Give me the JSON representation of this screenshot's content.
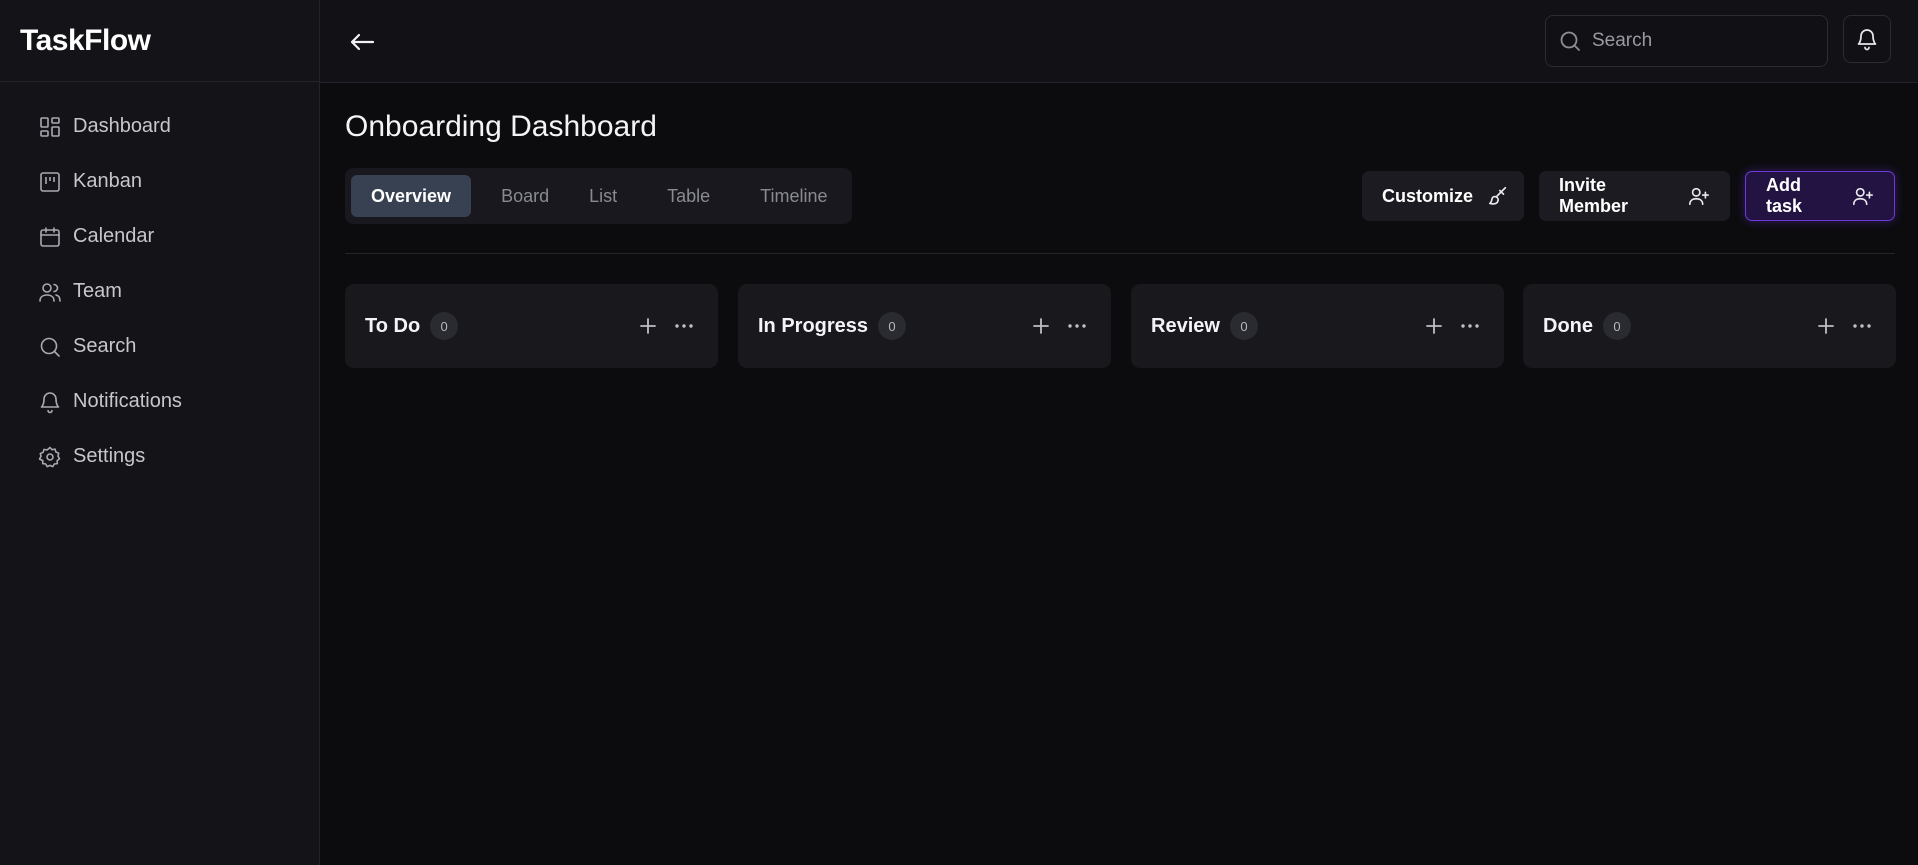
{
  "app": {
    "brand": "TaskFlow"
  },
  "sidebar": {
    "items": [
      {
        "label": "Dashboard",
        "icon": "dashboard-icon"
      },
      {
        "label": "Kanban",
        "icon": "kanban-icon"
      },
      {
        "label": "Calendar",
        "icon": "calendar-icon"
      },
      {
        "label": "Team",
        "icon": "team-icon"
      },
      {
        "label": "Search",
        "icon": "search-icon"
      },
      {
        "label": "Notifications",
        "icon": "bell-icon"
      },
      {
        "label": "Settings",
        "icon": "gear-icon"
      }
    ]
  },
  "topbar": {
    "back_icon": "arrow-left-icon",
    "search": {
      "placeholder": "Search",
      "value": ""
    },
    "notifications_icon": "bell-icon"
  },
  "main": {
    "title": "Onboarding Dashboard",
    "tabs": [
      {
        "label": "Overview",
        "active": true
      },
      {
        "label": "Board",
        "active": false
      },
      {
        "label": "List",
        "active": false
      },
      {
        "label": "Table",
        "active": false
      },
      {
        "label": "Timeline",
        "active": false
      }
    ],
    "actions": {
      "customize": {
        "label": "Customize",
        "icon": "paintbrush-icon"
      },
      "invite": {
        "label": "Invite Member",
        "icon": "user-plus-icon"
      },
      "add_task": {
        "label": "Add task",
        "icon": "user-plus-icon"
      }
    },
    "columns": [
      {
        "title": "To Do",
        "count": "0"
      },
      {
        "title": "In Progress",
        "count": "0"
      },
      {
        "title": "Review",
        "count": "0"
      },
      {
        "title": "Done",
        "count": "0"
      }
    ]
  },
  "colors": {
    "background": "#0c0c0f",
    "sidebar": "#131318",
    "accent": "#6d3ad7",
    "active_tab": "#374152"
  }
}
